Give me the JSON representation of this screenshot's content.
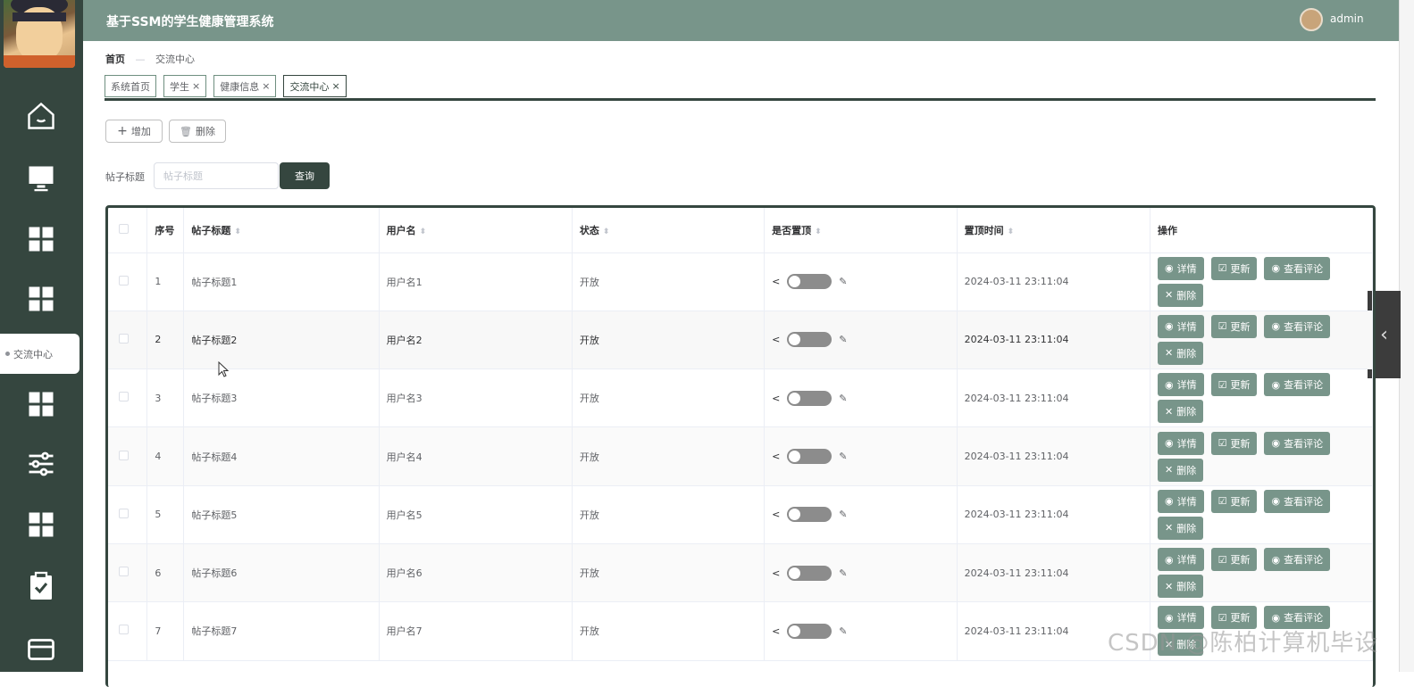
{
  "app": {
    "title": "基于SSM的学生健康管理系统",
    "user": "admin"
  },
  "sidebar": {
    "active_label": "交流中心"
  },
  "breadcrumb": {
    "home": "首页",
    "separator": "—",
    "current": "交流中心"
  },
  "tabs": [
    {
      "label": "系统首页",
      "closable": false
    },
    {
      "label": "学生",
      "closable": true
    },
    {
      "label": "健康信息",
      "closable": true
    },
    {
      "label": "交流中心",
      "closable": true
    }
  ],
  "toolbar": {
    "add_label": "增加",
    "delete_label": "删除"
  },
  "search": {
    "label": "帖子标题",
    "placeholder": "帖子标题",
    "button": "查询"
  },
  "table": {
    "headers": {
      "index": "序号",
      "title": "帖子标题",
      "username": "用户名",
      "status": "状态",
      "pinned": "是否置顶",
      "pin_time": "置顶时间",
      "actions": "操作"
    },
    "rows": [
      {
        "index": "1",
        "title": "帖子标题1",
        "username": "用户名1",
        "status": "开放",
        "pin_time": "2024-03-11 23:11:04"
      },
      {
        "index": "2",
        "title": "帖子标题2",
        "username": "用户名2",
        "status": "开放",
        "pin_time": "2024-03-11 23:11:04"
      },
      {
        "index": "3",
        "title": "帖子标题3",
        "username": "用户名3",
        "status": "开放",
        "pin_time": "2024-03-11 23:11:04"
      },
      {
        "index": "4",
        "title": "帖子标题4",
        "username": "用户名4",
        "status": "开放",
        "pin_time": "2024-03-11 23:11:04"
      },
      {
        "index": "5",
        "title": "帖子标题5",
        "username": "用户名5",
        "status": "开放",
        "pin_time": "2024-03-11 23:11:04"
      },
      {
        "index": "6",
        "title": "帖子标题6",
        "username": "用户名6",
        "status": "开放",
        "pin_time": "2024-03-11 23:11:04"
      },
      {
        "index": "7",
        "title": "帖子标题7",
        "username": "用户名7",
        "status": "开放",
        "pin_time": "2024-03-11 23:11:04"
      }
    ],
    "actions": {
      "detail": "详情",
      "update": "更新",
      "comments": "查看评论",
      "delete": "删除"
    }
  },
  "watermark": "CSDN @陈柏计算机毕设",
  "colors": {
    "sidebar": "#35463f",
    "header": "#78958a",
    "button": "#78958a",
    "primary": "#35463f"
  }
}
